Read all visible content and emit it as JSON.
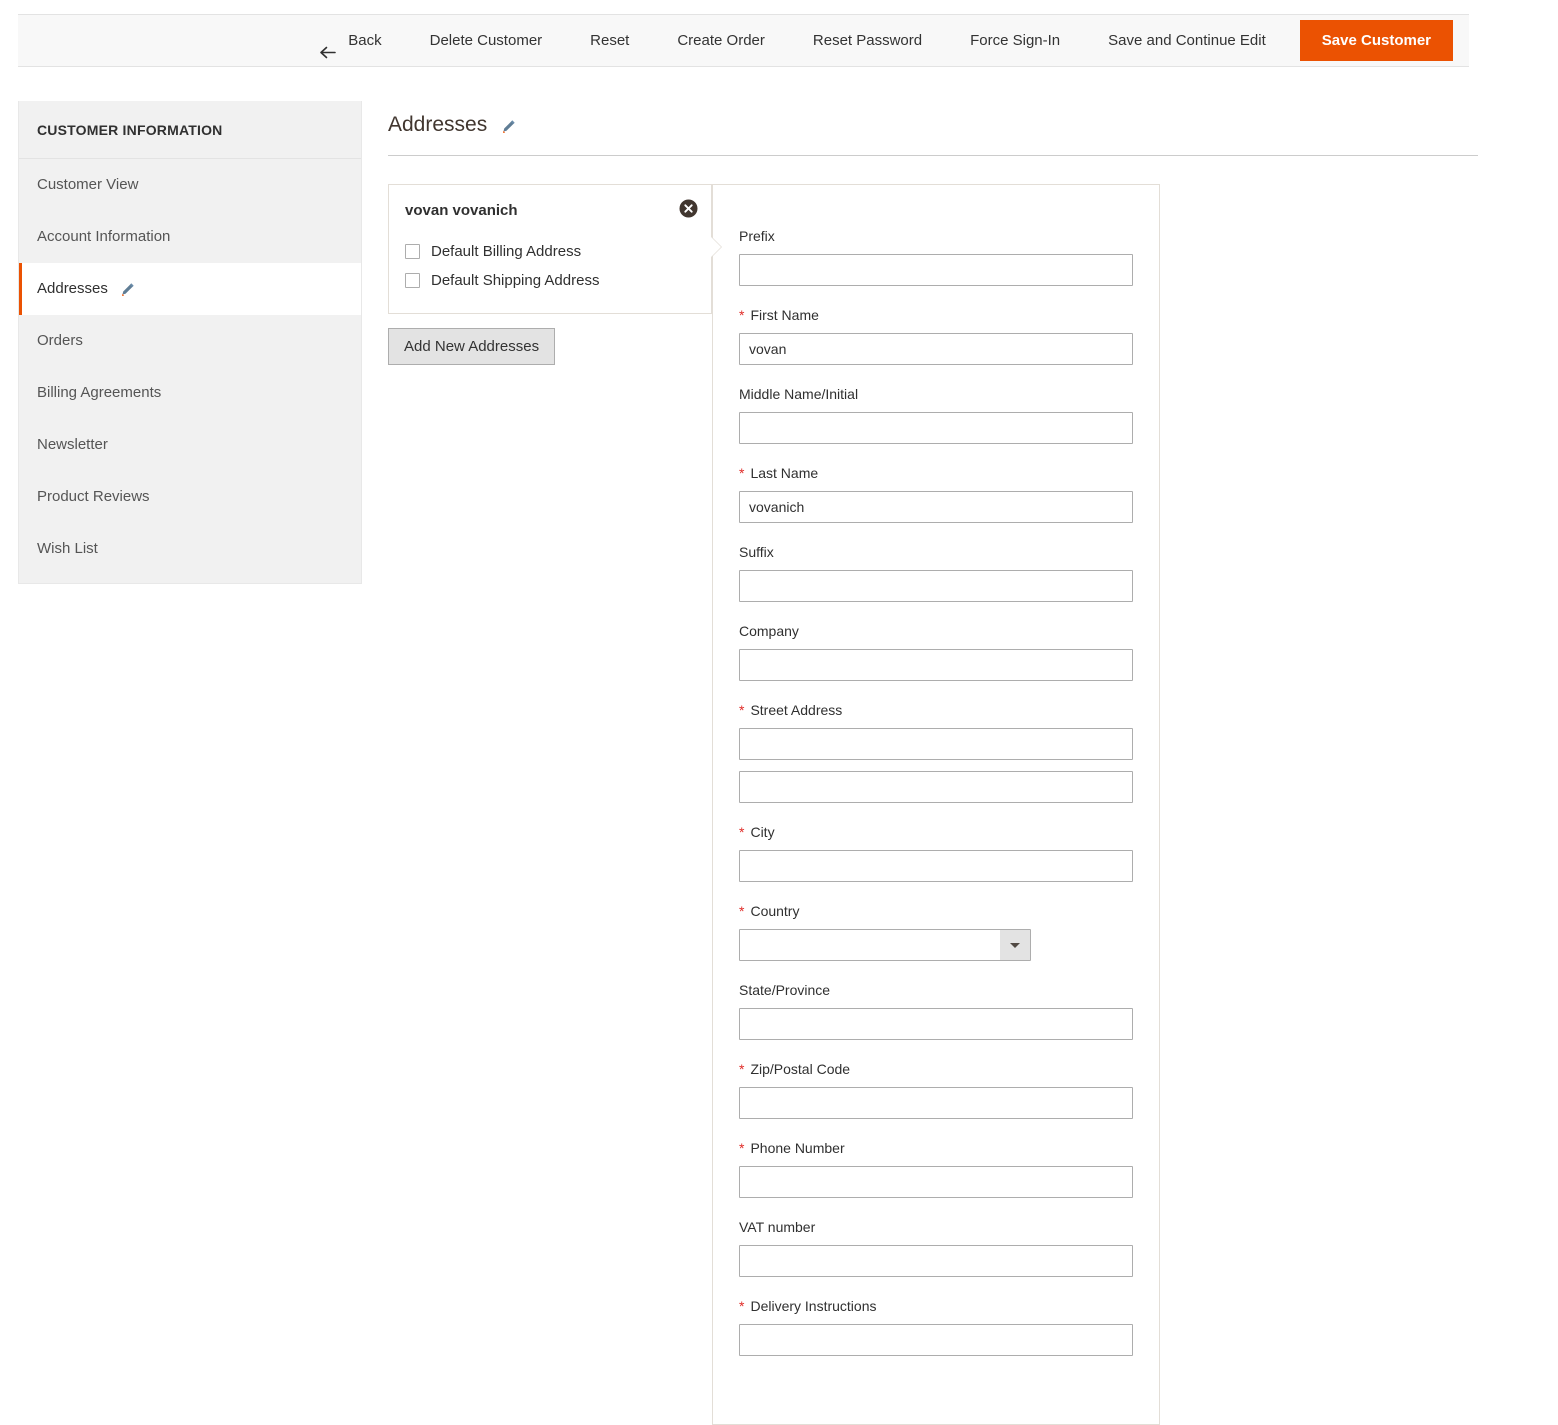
{
  "toolbar": {
    "back_label": "Back",
    "back_icon": "arrow-left-icon",
    "buttons": [
      {
        "label": "Delete Customer",
        "name": "delete-customer-button"
      },
      {
        "label": "Reset",
        "name": "reset-button"
      },
      {
        "label": "Create Order",
        "name": "create-order-button"
      },
      {
        "label": "Reset Password",
        "name": "reset-password-button"
      },
      {
        "label": "Force Sign-In",
        "name": "force-sign-in-button"
      },
      {
        "label": "Save and Continue Edit",
        "name": "save-and-continue-edit-button"
      }
    ],
    "primary_label": "Save Customer",
    "primary_color": "#eb5202"
  },
  "sidebar": {
    "title": "CUSTOMER INFORMATION",
    "items": [
      {
        "label": "Customer View",
        "active": false
      },
      {
        "label": "Account Information",
        "active": false
      },
      {
        "label": "Addresses",
        "active": true,
        "icon": "pencil-icon"
      },
      {
        "label": "Orders",
        "active": false
      },
      {
        "label": "Billing Agreements",
        "active": false
      },
      {
        "label": "Newsletter",
        "active": false
      },
      {
        "label": "Product Reviews",
        "active": false
      },
      {
        "label": "Wish List",
        "active": false
      }
    ],
    "accent_color": "#eb5202"
  },
  "main": {
    "title": "Addresses",
    "title_icon": "pencil-icon",
    "address_card": {
      "name": "vovan vovanich",
      "close_icon": "close-circle-icon",
      "checkboxes": [
        {
          "label": "Default Billing Address",
          "checked": false
        },
        {
          "label": "Default Shipping Address",
          "checked": false
        }
      ]
    },
    "add_new_label": "Add New Addresses",
    "form": {
      "fields": [
        {
          "label": "Prefix",
          "required": false,
          "value": "",
          "type": "text"
        },
        {
          "label": "First Name",
          "required": true,
          "value": "vovan",
          "type": "text"
        },
        {
          "label": "Middle Name/Initial",
          "required": false,
          "value": "",
          "type": "text"
        },
        {
          "label": "Last Name",
          "required": true,
          "value": "vovanich",
          "type": "text"
        },
        {
          "label": "Suffix",
          "required": false,
          "value": "",
          "type": "text"
        },
        {
          "label": "Company",
          "required": false,
          "value": "",
          "type": "text"
        },
        {
          "label": "Street Address",
          "required": true,
          "value": "",
          "value2": "",
          "type": "text-multi"
        },
        {
          "label": "City",
          "required": true,
          "value": "",
          "type": "text"
        },
        {
          "label": "Country",
          "required": true,
          "value": "",
          "type": "select"
        },
        {
          "label": "State/Province",
          "required": false,
          "value": "",
          "type": "text"
        },
        {
          "label": "Zip/Postal Code",
          "required": true,
          "value": "",
          "type": "text"
        },
        {
          "label": "Phone Number",
          "required": true,
          "value": "",
          "type": "text"
        },
        {
          "label": "VAT number",
          "required": false,
          "value": "",
          "type": "text"
        },
        {
          "label": "Delivery Instructions",
          "required": true,
          "value": "",
          "type": "text"
        }
      ]
    }
  }
}
